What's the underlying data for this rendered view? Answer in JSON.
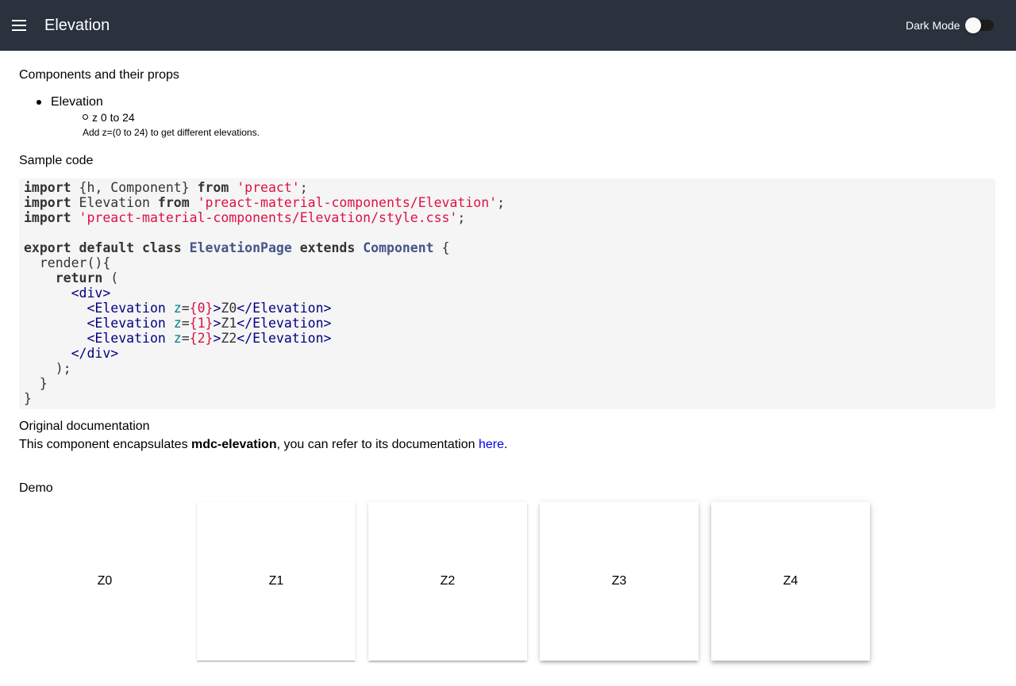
{
  "header": {
    "title": "Elevation",
    "dark_mode_label": "Dark Mode",
    "dark_mode_on": false,
    "background": "#2a323d"
  },
  "props_section": {
    "heading": "Components and their props",
    "component_name": "Elevation",
    "prop_name": "z",
    "prop_range": "0 to 24",
    "prop_description": "Add z=(0 to 24) to get different elevations."
  },
  "sample_code": {
    "heading": "Sample code",
    "lines": [
      "import {h, Component} from 'preact';",
      "import Elevation from 'preact-material-components/Elevation';",
      "import 'preact-material-components/Elevation/style.css';",
      "",
      "export default class ElevationPage extends Component {",
      "  render(){",
      "    return (",
      "      <div>",
      "        <Elevation z={0}>Z0</Elevation>",
      "        <Elevation z={1}>Z1</Elevation>",
      "        <Elevation z={2}>Z2</Elevation>",
      "      </div>",
      "    );",
      "  }",
      "}"
    ]
  },
  "original_docs": {
    "heading": "Original documentation",
    "text_before": "This component encapsulates ",
    "component_bold": "mdc-elevation",
    "text_middle": ", you can refer to its documentation ",
    "link_text": "here",
    "text_after": "."
  },
  "demo": {
    "heading": "Demo",
    "cards": [
      {
        "label": "Z0",
        "z": 0
      },
      {
        "label": "Z1",
        "z": 1
      },
      {
        "label": "Z2",
        "z": 2
      },
      {
        "label": "Z3",
        "z": 3
      },
      {
        "label": "Z4",
        "z": 4
      }
    ]
  }
}
